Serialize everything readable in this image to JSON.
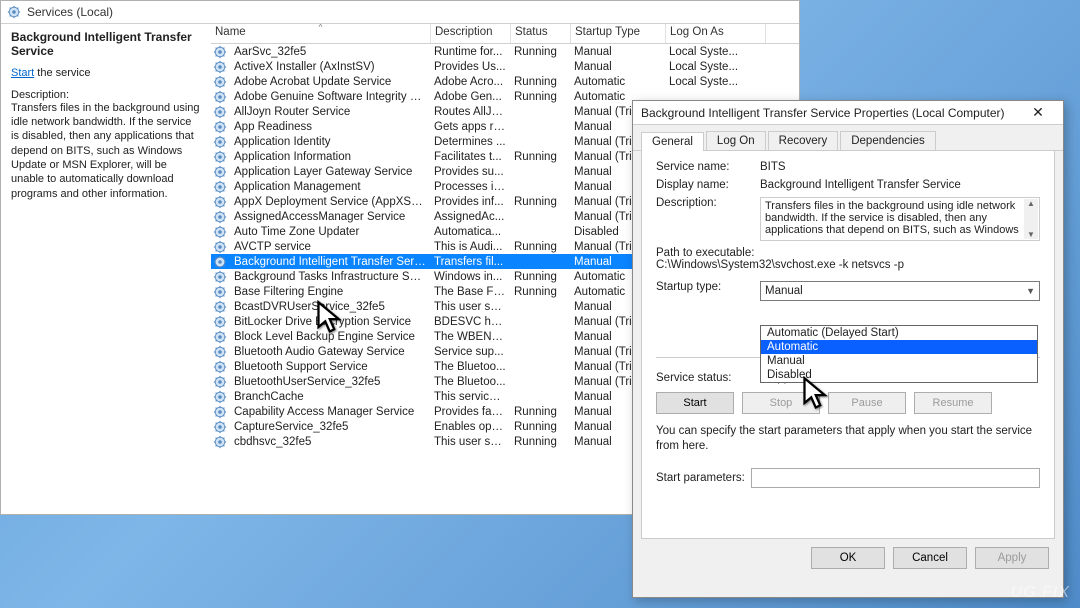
{
  "titlebar": "Services (Local)",
  "leftpane": {
    "service_name": "Background Intelligent Transfer Service",
    "start_link": "Start",
    "start_suffix": " the service",
    "desc_label": "Description:",
    "desc_text": "Transfers files in the background using idle network bandwidth. If the service is disabled, then any applications that depend on BITS, such as Windows Update or MSN Explorer, will be unable to automatically download programs and other information."
  },
  "columns": {
    "name": "Name",
    "desc": "Description",
    "status": "Status",
    "startup": "Startup Type",
    "logon": "Log On As"
  },
  "rows": [
    {
      "n": "AarSvc_32fe5",
      "d": "Runtime for...",
      "s": "Running",
      "t": "Manual",
      "l": "Local Syste..."
    },
    {
      "n": "ActiveX Installer (AxInstSV)",
      "d": "Provides Us...",
      "s": "",
      "t": "Manual",
      "l": "Local Syste..."
    },
    {
      "n": "Adobe Acrobat Update Service",
      "d": "Adobe Acro...",
      "s": "Running",
      "t": "Automatic",
      "l": "Local Syste..."
    },
    {
      "n": "Adobe Genuine Software Integrity Service",
      "d": "Adobe Gen...",
      "s": "Running",
      "t": "Automatic",
      "l": ""
    },
    {
      "n": "AllJoyn Router Service",
      "d": "Routes AllJo...",
      "s": "",
      "t": "Manual (Trig...",
      "l": ""
    },
    {
      "n": "App Readiness",
      "d": "Gets apps re...",
      "s": "",
      "t": "Manual",
      "l": ""
    },
    {
      "n": "Application Identity",
      "d": "Determines ...",
      "s": "",
      "t": "Manual (Trig...",
      "l": ""
    },
    {
      "n": "Application Information",
      "d": "Facilitates t...",
      "s": "Running",
      "t": "Manual (Trig...",
      "l": ""
    },
    {
      "n": "Application Layer Gateway Service",
      "d": "Provides su...",
      "s": "",
      "t": "Manual",
      "l": ""
    },
    {
      "n": "Application Management",
      "d": "Processes in...",
      "s": "",
      "t": "Manual",
      "l": ""
    },
    {
      "n": "AppX Deployment Service (AppXSVC)",
      "d": "Provides inf...",
      "s": "Running",
      "t": "Manual (Trig...",
      "l": ""
    },
    {
      "n": "AssignedAccessManager Service",
      "d": "AssignedAc...",
      "s": "",
      "t": "Manual (Trig...",
      "l": ""
    },
    {
      "n": "Auto Time Zone Updater",
      "d": "Automatica...",
      "s": "",
      "t": "Disabled",
      "l": ""
    },
    {
      "n": "AVCTP service",
      "d": "This is Audi...",
      "s": "Running",
      "t": "Manual (Trig...",
      "l": ""
    },
    {
      "n": "Background Intelligent Transfer Service",
      "d": "Transfers fil...",
      "s": "",
      "t": "Manual",
      "l": "",
      "sel": true
    },
    {
      "n": "Background Tasks Infrastructure Service",
      "d": "Windows in...",
      "s": "Running",
      "t": "Automatic",
      "l": ""
    },
    {
      "n": "Base Filtering Engine",
      "d": "The Base Fil...",
      "s": "Running",
      "t": "Automatic",
      "l": ""
    },
    {
      "n": "BcastDVRUserService_32fe5",
      "d": "This user ser...",
      "s": "",
      "t": "Manual",
      "l": ""
    },
    {
      "n": "BitLocker Drive Encryption Service",
      "d": "BDESVC hos...",
      "s": "",
      "t": "Manual (Trig...",
      "l": ""
    },
    {
      "n": "Block Level Backup Engine Service",
      "d": "The WBENG...",
      "s": "",
      "t": "Manual",
      "l": ""
    },
    {
      "n": "Bluetooth Audio Gateway Service",
      "d": "Service sup...",
      "s": "",
      "t": "Manual (Trig...",
      "l": ""
    },
    {
      "n": "Bluetooth Support Service",
      "d": "The Bluetoo...",
      "s": "",
      "t": "Manual (Trig...",
      "l": ""
    },
    {
      "n": "BluetoothUserService_32fe5",
      "d": "The Bluetoo...",
      "s": "",
      "t": "Manual (Trig...",
      "l": ""
    },
    {
      "n": "BranchCache",
      "d": "This service ...",
      "s": "",
      "t": "Manual",
      "l": ""
    },
    {
      "n": "Capability Access Manager Service",
      "d": "Provides fac...",
      "s": "Running",
      "t": "Manual",
      "l": ""
    },
    {
      "n": "CaptureService_32fe5",
      "d": "Enables opti...",
      "s": "Running",
      "t": "Manual",
      "l": ""
    },
    {
      "n": "cbdhsvc_32fe5",
      "d": "This user ser...",
      "s": "Running",
      "t": "Manual",
      "l": ""
    }
  ],
  "dialog": {
    "title": "Background Intelligent Transfer Service Properties (Local Computer)",
    "tabs": [
      "General",
      "Log On",
      "Recovery",
      "Dependencies"
    ],
    "labels": {
      "svc_name": "Service name:",
      "disp_name": "Display name:",
      "desc": "Description:",
      "path": "Path to executable:",
      "startup": "Startup type:",
      "status": "Service status:",
      "note": "You can specify the start parameters that apply when you start the service from here.",
      "params": "Start parameters:"
    },
    "values": {
      "svc_name": "BITS",
      "disp_name": "Background Intelligent Transfer Service",
      "desc": "Transfers files in the background using idle network bandwidth. If the service is disabled, then any applications that depend on BITS, such as Windows",
      "path": "C:\\Windows\\System32\\svchost.exe -k netsvcs -p",
      "startup_sel": "Manual",
      "status": "Stopped"
    },
    "dropdown": [
      "Automatic (Delayed Start)",
      "Automatic",
      "Manual",
      "Disabled"
    ],
    "dropdown_hl": 1,
    "buttons": {
      "start": "Start",
      "stop": "Stop",
      "pause": "Pause",
      "resume": "Resume",
      "ok": "OK",
      "cancel": "Cancel",
      "apply": "Apply"
    }
  },
  "watermark": "UG   FIX"
}
